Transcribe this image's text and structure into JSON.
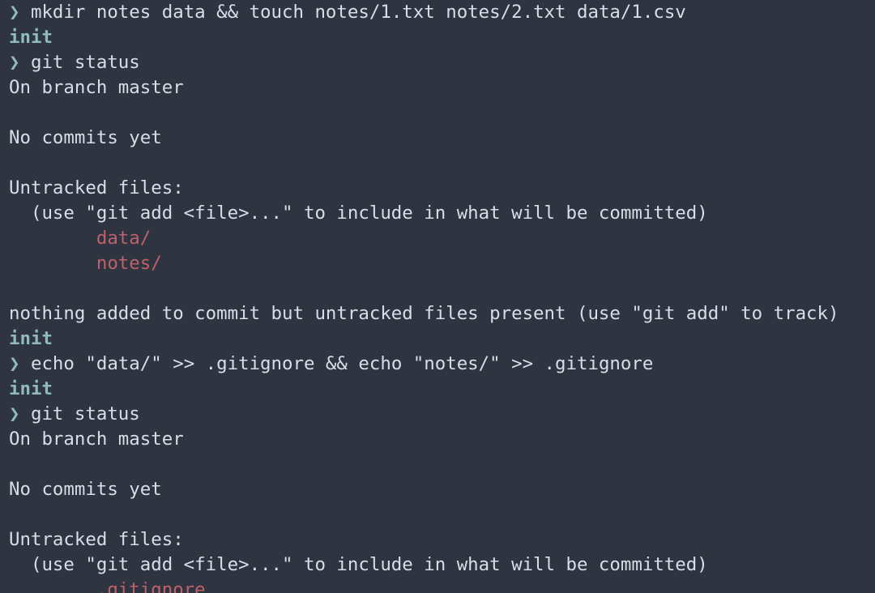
{
  "colors": {
    "background": "#2e3440",
    "text": "#d8dee9",
    "prompt": "#8fbcbb",
    "untracked": "#bf616a"
  },
  "terminal": {
    "lines": [
      {
        "type": "command",
        "prompt": "❯",
        "text": "mkdir notes data && touch notes/1.txt notes/2.txt data/1.csv"
      },
      {
        "type": "branch",
        "text": "init"
      },
      {
        "type": "command",
        "prompt": "❯",
        "text": "git status"
      },
      {
        "type": "output",
        "text": "On branch master"
      },
      {
        "type": "output",
        "text": ""
      },
      {
        "type": "output",
        "text": "No commits yet"
      },
      {
        "type": "output",
        "text": ""
      },
      {
        "type": "output",
        "text": "Untracked files:"
      },
      {
        "type": "output",
        "text": "  (use \"git add <file>...\" to include in what will be committed)"
      },
      {
        "type": "untracked",
        "indent": "        ",
        "text": "data/"
      },
      {
        "type": "untracked",
        "indent": "        ",
        "text": "notes/"
      },
      {
        "type": "output",
        "text": ""
      },
      {
        "type": "output",
        "text": "nothing added to commit but untracked files present (use \"git add\" to track)"
      },
      {
        "type": "branch",
        "text": "init"
      },
      {
        "type": "command",
        "prompt": "❯",
        "text": "echo \"data/\" >> .gitignore && echo \"notes/\" >> .gitignore"
      },
      {
        "type": "branch",
        "text": "init"
      },
      {
        "type": "command",
        "prompt": "❯",
        "text": "git status"
      },
      {
        "type": "output",
        "text": "On branch master"
      },
      {
        "type": "output",
        "text": ""
      },
      {
        "type": "output",
        "text": "No commits yet"
      },
      {
        "type": "output",
        "text": ""
      },
      {
        "type": "output",
        "text": "Untracked files:"
      },
      {
        "type": "output",
        "text": "  (use \"git add <file>...\" to include in what will be committed)"
      },
      {
        "type": "untracked",
        "indent": "        ",
        "text": ".gitignore"
      }
    ]
  }
}
